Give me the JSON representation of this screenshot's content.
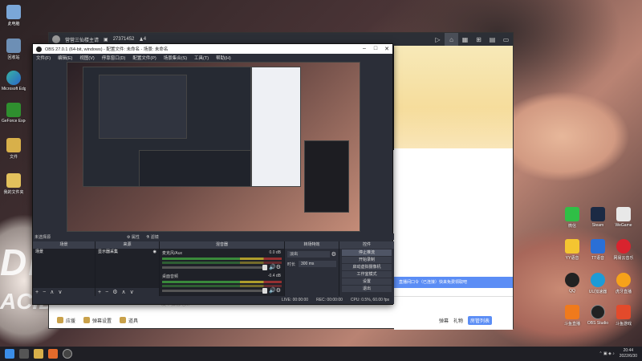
{
  "client": {
    "stream_title": "营营三仙楼主请",
    "viewer_count": "27371452",
    "fans": "4",
    "input_placeholder": "发个弹幕吧...",
    "tools": [
      "应援",
      "弹幕设置",
      "道具"
    ],
    "right_tools": [
      "弹幕",
      "礼物"
    ],
    "close_label": "房管列表",
    "chat_message": "直播间口令（已连接）快来免费领取吧"
  },
  "obs": {
    "title": "OBS 27.0.1 (64-bit, windows) - 配置文件: 未命名 - 场景: 未命名",
    "menu": [
      "文件(F)",
      "编辑(E)",
      "视图(V)",
      "停靠窗口(D)",
      "配置文件(P)",
      "场景集合(S)",
      "工具(T)",
      "帮助(H)"
    ],
    "status_label": "未选择源",
    "props_label": "属性",
    "filters_label": "滤镜",
    "docks": {
      "scenes": {
        "title": "场景",
        "items": [
          "场景"
        ]
      },
      "sources": {
        "title": "来源",
        "items": [
          "显示器采集"
        ]
      },
      "mixer": {
        "title": "混音器",
        "tracks": [
          {
            "name": "麦克风/Aux",
            "db": "0.0 dB"
          },
          {
            "name": "桌面音频",
            "db": "-0.4 dB"
          }
        ]
      },
      "transitions": {
        "title": "转场特效",
        "type": "淡出",
        "duration_label": "时长",
        "duration": "300 ms"
      },
      "controls": {
        "title": "控件",
        "buttons": [
          "停止推流",
          "开始录制",
          "启动虚拟摄像机",
          "工作室模式",
          "设置",
          "退出"
        ]
      }
    },
    "statusline": {
      "live": "LIVE: 00:00:00",
      "rec": "REC: 00:00:00",
      "cpu": "CPU: 0.5%, 60.00 fps"
    }
  },
  "desktop": {
    "icons_left": [
      "此电脑",
      "回收站",
      "Microsoft Edge",
      "GeForce Experience",
      "文件",
      "我的文件夹"
    ],
    "icons_right": [
      [
        "微信",
        "Steam",
        "WeGame"
      ],
      [
        "YY语音",
        "TT语音",
        "网易云音乐"
      ],
      [
        "QQ",
        "UU加速器",
        "虎牙直播"
      ],
      [
        "斗鱼直播",
        "OBS Studio",
        "斗鱼游戏"
      ]
    ]
  },
  "taskbar": {
    "time": "20:44",
    "date": "2022/6/30"
  },
  "colors": {
    "accent": "#5b8df5",
    "obs_bg": "#2b2e38"
  }
}
